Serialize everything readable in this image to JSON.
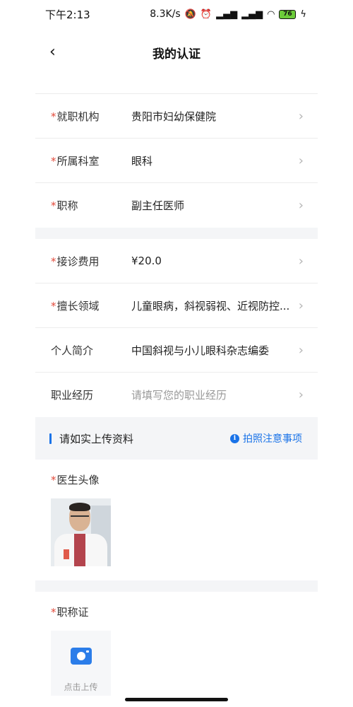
{
  "status_bar": {
    "time": "下午2:13",
    "network_speed": "8.3K/s",
    "battery_level": "76",
    "icons": [
      "silent-icon",
      "alarm-icon",
      "signal-icon",
      "signal-icon",
      "wifi-icon",
      "battery-icon",
      "charging-icon"
    ]
  },
  "nav": {
    "title": "我的认证"
  },
  "fields": [
    {
      "label": "就职机构",
      "required": "*",
      "value": "贵阳市妇幼保健院"
    },
    {
      "label": "所属科室",
      "required": "*",
      "value": "眼科"
    },
    {
      "label": "职称",
      "required": "*",
      "value": "副主任医师"
    },
    {
      "label": "接诊费用",
      "required": "*",
      "value": "¥20.0"
    },
    {
      "label": "擅长领域",
      "required": "*",
      "value": "儿童眼病，斜视弱视、近视防控..."
    },
    {
      "label": "个人简介",
      "value": "中国斜视与小儿眼科杂志编委"
    },
    {
      "label": "职业经历",
      "placeholder": "请填写您的职业经历"
    }
  ],
  "upload": {
    "header_title": "请如实上传资料",
    "tip_label": "拍照注意事项",
    "avatar_label": "医生头像",
    "avatar_required": "*",
    "cert_label": "职称证",
    "cert_required": "*",
    "upload_button_label": "点击上传"
  },
  "colors": {
    "accent": "#1a73e8",
    "required": "#e24a3b",
    "section_bg": "#f4f5f7"
  }
}
